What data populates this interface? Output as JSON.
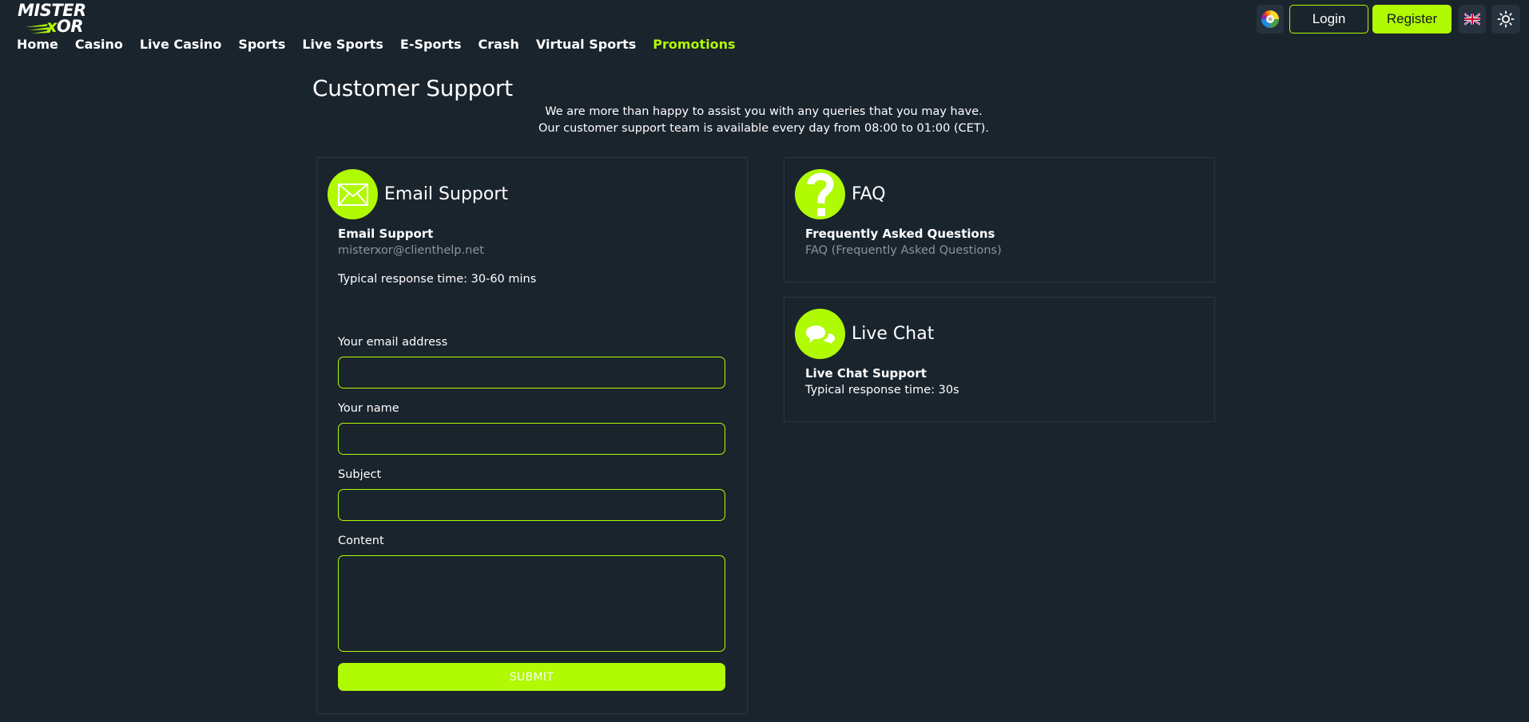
{
  "brand": {
    "logo_line1": "MISTER",
    "logo_x": "x",
    "logo_or": "OR",
    "accent_color": "#b0fa04",
    "background_color": "#1a242d"
  },
  "nav": {
    "items": [
      {
        "label": "Home"
      },
      {
        "label": "Casino"
      },
      {
        "label": "Live Casino"
      },
      {
        "label": "Sports"
      },
      {
        "label": "Live Sports"
      },
      {
        "label": "E-Sports"
      },
      {
        "label": "Crash"
      },
      {
        "label": "Virtual Sports"
      },
      {
        "label": "Promotions",
        "active": true
      }
    ]
  },
  "header": {
    "wheel_icon": "color-wheel-icon",
    "login_label": "Login",
    "register_label": "Register",
    "language_icon": "uk-flag-icon",
    "theme_icon": "sun-icon"
  },
  "page": {
    "title": "Customer Support",
    "intro_line1": "We are more than happy to assist you with any queries that you may have.",
    "intro_line2": "Our customer support team is available every day from 08:00 to 01:00 (CET)."
  },
  "email_card": {
    "icon": "envelope-icon",
    "title": "Email Support",
    "subtitle": "Email Support",
    "email": "misterxor@clienthelp.net",
    "response_time": "Typical response time: 30-60 mins",
    "form": {
      "email_label": "Your email address",
      "email_value": "",
      "name_label": "Your name",
      "name_value": "",
      "subject_label": "Subject",
      "subject_value": "",
      "content_label": "Content",
      "content_value": "",
      "submit_label": "SUBMIT"
    }
  },
  "faq_card": {
    "icon": "question-mark-icon",
    "title": "FAQ",
    "subtitle": "Frequently Asked Questions",
    "link": "FAQ (Frequently Asked Questions)"
  },
  "chat_card": {
    "icon": "chat-bubbles-icon",
    "title": "Live Chat",
    "subtitle": "Live Chat Support",
    "response_time": "Typical response time: 30s"
  }
}
